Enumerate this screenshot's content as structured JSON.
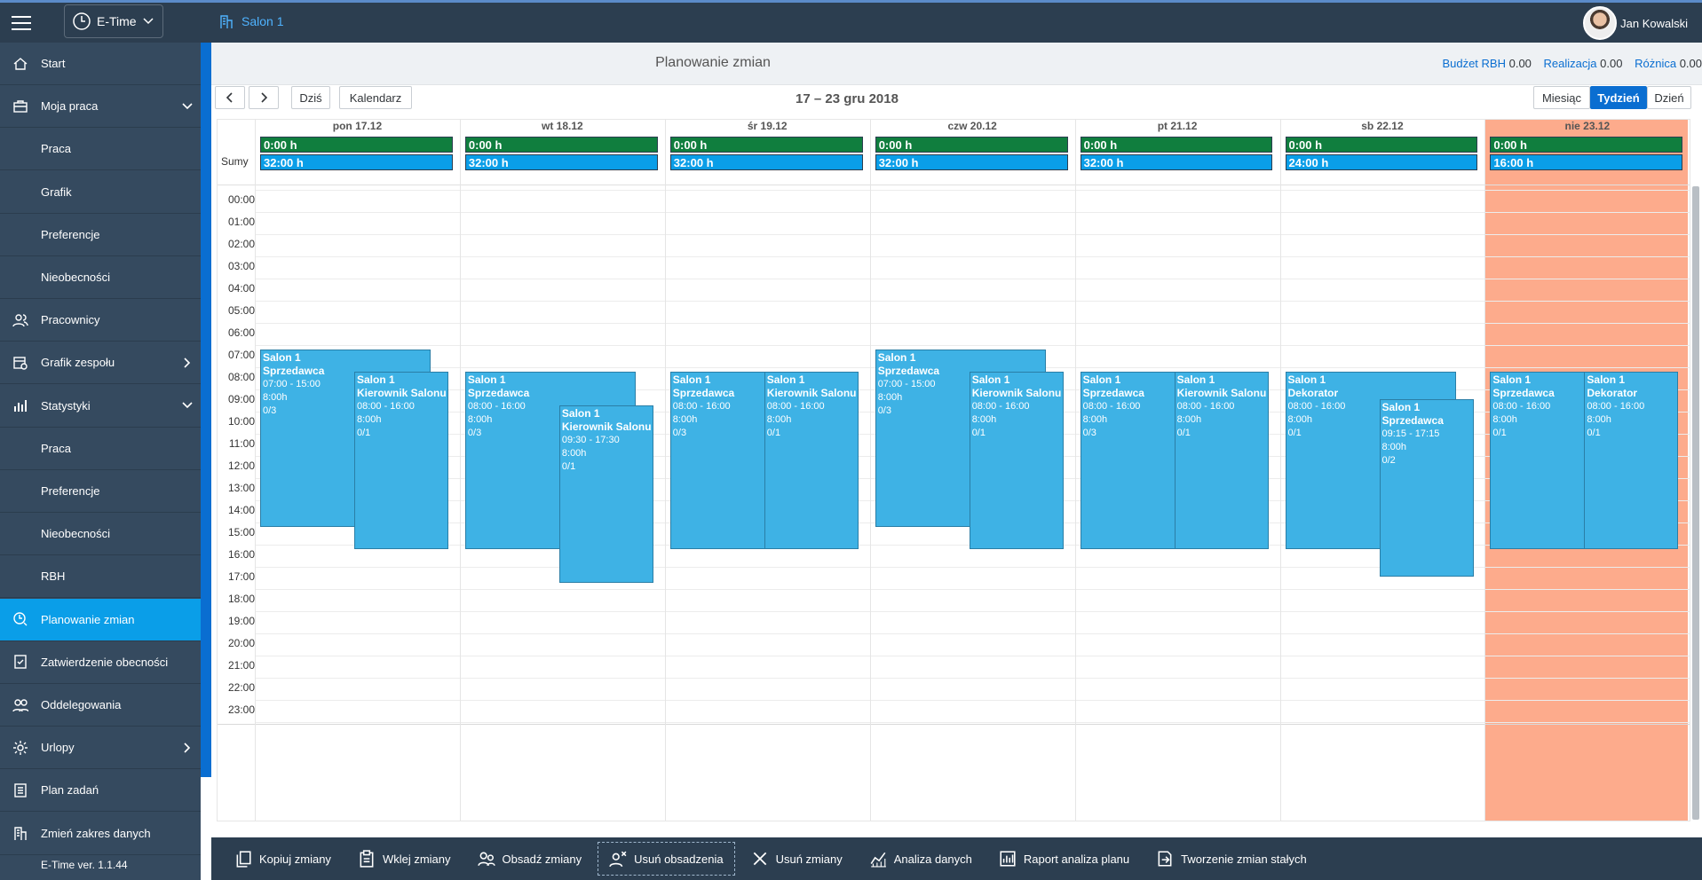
{
  "app": {
    "name": "E-Time",
    "context": "Salon 1",
    "user": "Jan Kowalski",
    "version": "E-Time ver. 1.1.44"
  },
  "sidebar": {
    "items": [
      {
        "label": "Start",
        "icon": "home-icon",
        "sub": false
      },
      {
        "label": "Moja praca",
        "icon": "briefcase-icon",
        "sub": false,
        "arrow": "down"
      },
      {
        "label": "Praca",
        "sub": true
      },
      {
        "label": "Grafik",
        "sub": true
      },
      {
        "label": "Preferencje",
        "sub": true
      },
      {
        "label": "Nieobecności",
        "sub": true
      },
      {
        "label": "Pracownicy",
        "icon": "people-icon",
        "sub": false
      },
      {
        "label": "Grafik zespołu",
        "icon": "team-schedule-icon",
        "sub": false,
        "arrow": "right"
      },
      {
        "label": "Statystyki",
        "icon": "bar-chart-icon",
        "sub": false,
        "arrow": "down"
      },
      {
        "label": "Praca",
        "sub": true
      },
      {
        "label": "Preferencje",
        "sub": true
      },
      {
        "label": "Nieobecności",
        "sub": true
      },
      {
        "label": "RBH",
        "sub": true
      },
      {
        "label": "Planowanie zmian",
        "icon": "planning-icon",
        "sub": false,
        "active": true
      },
      {
        "label": "Zatwierdzenie obecności",
        "icon": "approve-icon",
        "sub": false
      },
      {
        "label": "Oddelegowania",
        "icon": "delegation-icon",
        "sub": false
      },
      {
        "label": "Urlopy",
        "icon": "vacation-icon",
        "sub": false,
        "arrow": "right"
      },
      {
        "label": "Plan zadań",
        "icon": "tasks-icon",
        "sub": false
      },
      {
        "label": "Zmień zakres danych",
        "icon": "building-icon",
        "sub": false
      }
    ]
  },
  "header": {
    "title": "Planowanie zmian",
    "budget_label": "Budżet RBH",
    "budget_value": "0.00",
    "real_label": "Realizacja",
    "real_value": "0.00",
    "diff_label": "Różnica",
    "diff_value": "0.00"
  },
  "nav": {
    "today": "Dziś",
    "calendar": "Kalendarz",
    "range": "17 – 23 gru 2018",
    "views": [
      "Miesiąc",
      "Tydzień",
      "Dzień"
    ],
    "active_view": 1
  },
  "calendar": {
    "sum_label": "Sumy",
    "days": [
      {
        "label": "pon 17.12",
        "sum1": "0:00 h",
        "sum2": "32:00 h"
      },
      {
        "label": "wt 18.12",
        "sum1": "0:00 h",
        "sum2": "32:00 h"
      },
      {
        "label": "śr 19.12",
        "sum1": "0:00 h",
        "sum2": "32:00 h"
      },
      {
        "label": "czw 20.12",
        "sum1": "0:00 h",
        "sum2": "32:00 h"
      },
      {
        "label": "pt 21.12",
        "sum1": "0:00 h",
        "sum2": "32:00 h"
      },
      {
        "label": "sb 22.12",
        "sum1": "0:00 h",
        "sum2": "24:00 h"
      },
      {
        "label": "nie 23.12",
        "sum1": "0:00 h",
        "sum2": "16:00 h",
        "highlight": true
      }
    ],
    "hours": [
      "00:00",
      "01:00",
      "02:00",
      "03:00",
      "04:00",
      "05:00",
      "06:00",
      "07:00",
      "08:00",
      "09:00",
      "10:00",
      "11:00",
      "12:00",
      "13:00",
      "14:00",
      "15:00",
      "16:00",
      "17:00",
      "18:00",
      "19:00",
      "20:00",
      "21:00",
      "22:00",
      "23:00"
    ],
    "shifts": [
      {
        "day": 0,
        "col": 0,
        "start": 7,
        "end": 15,
        "loc": "Salon 1",
        "role": "Sprzedawca",
        "time": "07:00 - 15:00",
        "dur": "8:00h",
        "staff": "0/3"
      },
      {
        "day": 0,
        "col": 1,
        "start": 8,
        "end": 16,
        "loc": "Salon 1",
        "role": "Kierownik Salonu",
        "time": "08:00 - 16:00",
        "dur": "8:00h",
        "staff": "0/1"
      },
      {
        "day": 1,
        "col": 0,
        "start": 8,
        "end": 16,
        "loc": "Salon 1",
        "role": "Sprzedawca",
        "time": "08:00 - 16:00",
        "dur": "8:00h",
        "staff": "0/3"
      },
      {
        "day": 1,
        "col": 1,
        "start": 9.5,
        "end": 17.5,
        "loc": "Salon 1",
        "role": "Kierownik Salonu",
        "time": "09:30 - 17:30",
        "dur": "8:00h",
        "staff": "0/1"
      },
      {
        "day": 2,
        "col": 0,
        "start": 8,
        "end": 16,
        "loc": "Salon 1",
        "role": "Sprzedawca",
        "time": "08:00 - 16:00",
        "dur": "8:00h",
        "staff": "0/3"
      },
      {
        "day": 2,
        "col": 1,
        "start": 8,
        "end": 16,
        "loc": "Salon 1",
        "role": "Kierownik Salonu",
        "time": "08:00 - 16:00",
        "dur": "8:00h",
        "staff": "0/1"
      },
      {
        "day": 3,
        "col": 0,
        "start": 7,
        "end": 15,
        "loc": "Salon 1",
        "role": "Sprzedawca",
        "time": "07:00 - 15:00",
        "dur": "8:00h",
        "staff": "0/3"
      },
      {
        "day": 3,
        "col": 1,
        "start": 8,
        "end": 16,
        "loc": "Salon 1",
        "role": "Kierownik Salonu",
        "time": "08:00 - 16:00",
        "dur": "8:00h",
        "staff": "0/1"
      },
      {
        "day": 4,
        "col": 0,
        "start": 8,
        "end": 16,
        "loc": "Salon 1",
        "role": "Sprzedawca",
        "time": "08:00 - 16:00",
        "dur": "8:00h",
        "staff": "0/3"
      },
      {
        "day": 4,
        "col": 1,
        "start": 8,
        "end": 16,
        "loc": "Salon 1",
        "role": "Kierownik Salonu",
        "time": "08:00 - 16:00",
        "dur": "8:00h",
        "staff": "0/1"
      },
      {
        "day": 5,
        "col": 0,
        "start": 8,
        "end": 16,
        "loc": "Salon 1",
        "role": "Dekorator",
        "time": "08:00 - 16:00",
        "dur": "8:00h",
        "staff": "0/1"
      },
      {
        "day": 5,
        "col": 1,
        "start": 9.25,
        "end": 17.25,
        "loc": "Salon 1",
        "role": "Sprzedawca",
        "time": "09:15 - 17:15",
        "dur": "8:00h",
        "staff": "0/2"
      },
      {
        "day": 6,
        "col": 0,
        "start": 8,
        "end": 16,
        "loc": "Salon 1",
        "role": "Sprzedawca",
        "time": "08:00 - 16:00",
        "dur": "8:00h",
        "staff": "0/1"
      },
      {
        "day": 6,
        "col": 1,
        "start": 8,
        "end": 16,
        "loc": "Salon 1",
        "role": "Dekorator",
        "time": "08:00 - 16:00",
        "dur": "8:00h",
        "staff": "0/1"
      }
    ]
  },
  "toolbar": [
    {
      "label": "Kopiuj zmiany",
      "icon": "copy-icon"
    },
    {
      "label": "Wklej zmiany",
      "icon": "paste-icon"
    },
    {
      "label": "Obsadź zmiany",
      "icon": "assign-icon"
    },
    {
      "label": "Usuń obsadzenia",
      "icon": "unassign-icon",
      "focus": true
    },
    {
      "label": "Usuń zmiany",
      "icon": "delete-icon"
    },
    {
      "label": "Analiza danych",
      "icon": "analysis-icon"
    },
    {
      "label": "Raport analiza planu",
      "icon": "report-icon"
    },
    {
      "label": "Tworzenie zmian stałych",
      "icon": "create-shift-icon"
    }
  ]
}
